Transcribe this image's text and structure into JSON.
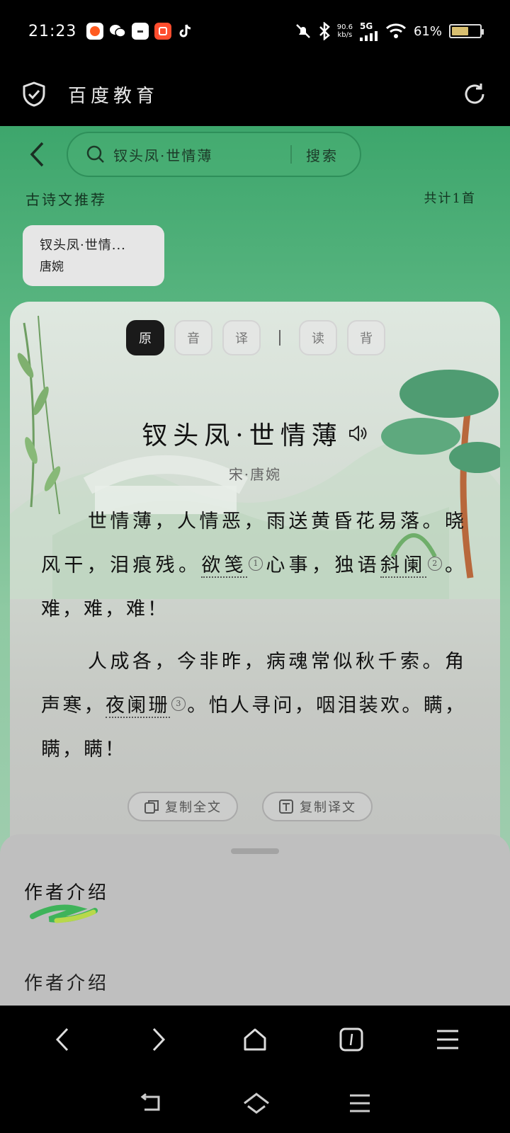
{
  "status_bar": {
    "time": "21:23",
    "net_speed_value": "90.6",
    "net_speed_unit": "kb/s",
    "network": "5G",
    "battery": "61%",
    "battery_level": 0.61
  },
  "header": {
    "title": "百度教育"
  },
  "search": {
    "query": "钗头凤·世情薄",
    "submit": "搜索"
  },
  "section": {
    "title": "古诗文推荐",
    "count": "共计1首"
  },
  "recommendation": {
    "title": "钗头凤·世情...",
    "author": "唐婉"
  },
  "tabs": [
    "原",
    "音",
    "译",
    "读",
    "背"
  ],
  "poem": {
    "title": "钗头凤·世情薄",
    "author": "宋·唐婉",
    "s1_a": "世情薄，人情恶，雨送黄昏花易落。晓风干，泪痕残。",
    "s1_note1": "欲笺",
    "s1_n1": "1",
    "s1_b": "心事，独语",
    "s1_note2": "斜阑",
    "s1_n2": "2",
    "s1_c": "。难，难，难！",
    "s2_a": "人成各，今非昨，病魂常似秋千索。角声寒，",
    "s2_note3": "夜阑珊",
    "s2_n3": "3",
    "s2_b": "。怕人寻问，咽泪装欢。瞒，瞒，瞒！"
  },
  "actions": {
    "copy_full": "复制全文",
    "copy_translation": "复制译文"
  },
  "sheet": {
    "heading": "作者介绍",
    "subheading": "作者介绍"
  }
}
